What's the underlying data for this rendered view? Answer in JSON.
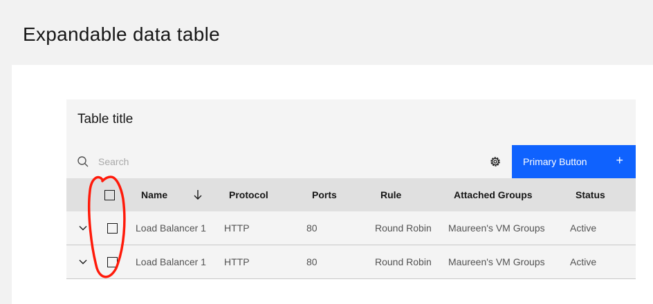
{
  "page": {
    "title": "Expandable data table"
  },
  "table": {
    "title": "Table title",
    "search_placeholder": "Search",
    "primary_button": {
      "label": "Primary Button",
      "icon": "+"
    },
    "columns": [
      "Name",
      "Protocol",
      "Ports",
      "Rule",
      "Attached Groups",
      "Status"
    ],
    "rows": [
      {
        "name": "Load Balancer 1",
        "protocol": "HTTP",
        "ports": "80",
        "rule": "Round Robin",
        "groups": "Maureen's VM Groups",
        "status": "Active"
      },
      {
        "name": "Load Balancer 1",
        "protocol": "HTTP",
        "ports": "80",
        "rule": "Round Robin",
        "groups": "Maureen's VM Groups",
        "status": "Active"
      }
    ]
  },
  "colors": {
    "accent": "#0f62fe",
    "annotation": "#ff1a0a",
    "header_bg": "#e0e0e0"
  },
  "icons": [
    "search-icon",
    "settings-icon",
    "sort-arrow-icon",
    "chevron-down-icon",
    "plus-icon"
  ]
}
